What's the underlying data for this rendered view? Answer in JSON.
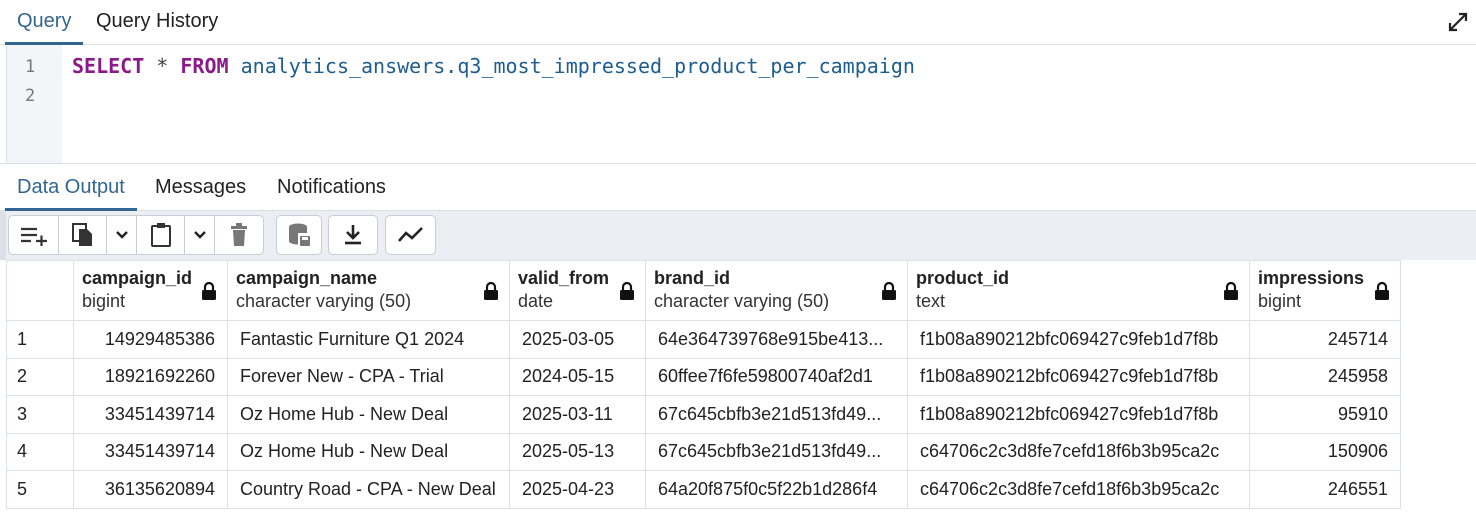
{
  "top_tabs": [
    "Query",
    "Query History"
  ],
  "editor": {
    "line_numbers": [
      "1",
      "2"
    ],
    "code": {
      "kw1": "SELECT",
      "star": "*",
      "kw2": "FROM",
      "table": "analytics_answers.q3_most_impressed_product_per_campaign"
    }
  },
  "bottom_tabs": [
    "Data Output",
    "Messages",
    "Notifications"
  ],
  "toolbar": {
    "icons": [
      "add-row-icon",
      "copy-icon",
      "chevron-down-icon",
      "paste-icon",
      "chevron-down-icon",
      "delete-icon",
      "save-data-icon",
      "download-icon",
      "graph-icon"
    ]
  },
  "grid": {
    "columns": [
      {
        "name": "campaign_id",
        "type": "bigint"
      },
      {
        "name": "campaign_name",
        "type": "character varying (50)"
      },
      {
        "name": "valid_from",
        "type": "date"
      },
      {
        "name": "brand_id",
        "type": "character varying (50)"
      },
      {
        "name": "product_id",
        "type": "text"
      },
      {
        "name": "impressions",
        "type": "bigint"
      }
    ],
    "rows": [
      {
        "n": "1",
        "campaign_id": "14929485386",
        "campaign_name": "Fantastic Furniture Q1 2024",
        "valid_from": "2025-03-05",
        "brand_id": "64e364739768e915be413...",
        "product_id": "f1b08a890212bfc069427c9feb1d7f8b",
        "impressions": "245714"
      },
      {
        "n": "2",
        "campaign_id": "18921692260",
        "campaign_name": "Forever New - CPA - Trial",
        "valid_from": "2024-05-15",
        "brand_id": "60ffee7f6fe59800740af2d1",
        "product_id": "f1b08a890212bfc069427c9feb1d7f8b",
        "impressions": "245958"
      },
      {
        "n": "3",
        "campaign_id": "33451439714",
        "campaign_name": "Oz Home Hub - New Deal",
        "valid_from": "2025-03-11",
        "brand_id": "67c645cbfb3e21d513fd49...",
        "product_id": "f1b08a890212bfc069427c9feb1d7f8b",
        "impressions": "95910"
      },
      {
        "n": "4",
        "campaign_id": "33451439714",
        "campaign_name": "Oz Home Hub - New Deal",
        "valid_from": "2025-05-13",
        "brand_id": "67c645cbfb3e21d513fd49...",
        "product_id": "c64706c2c3d8fe7cefd18f6b3b95ca2c",
        "impressions": "150906"
      },
      {
        "n": "5",
        "campaign_id": "36135620894",
        "campaign_name": "Country Road - CPA - New Deal",
        "valid_from": "2025-04-23",
        "brand_id": "64a20f875f0c5f22b1d286f4",
        "product_id": "c64706c2c3d8fe7cefd18f6b3b95ca2c",
        "impressions": "246551"
      }
    ]
  },
  "colors": {
    "accent": "#326690",
    "keyword": "#8a1a8a",
    "identifier": "#1d5d8f"
  }
}
